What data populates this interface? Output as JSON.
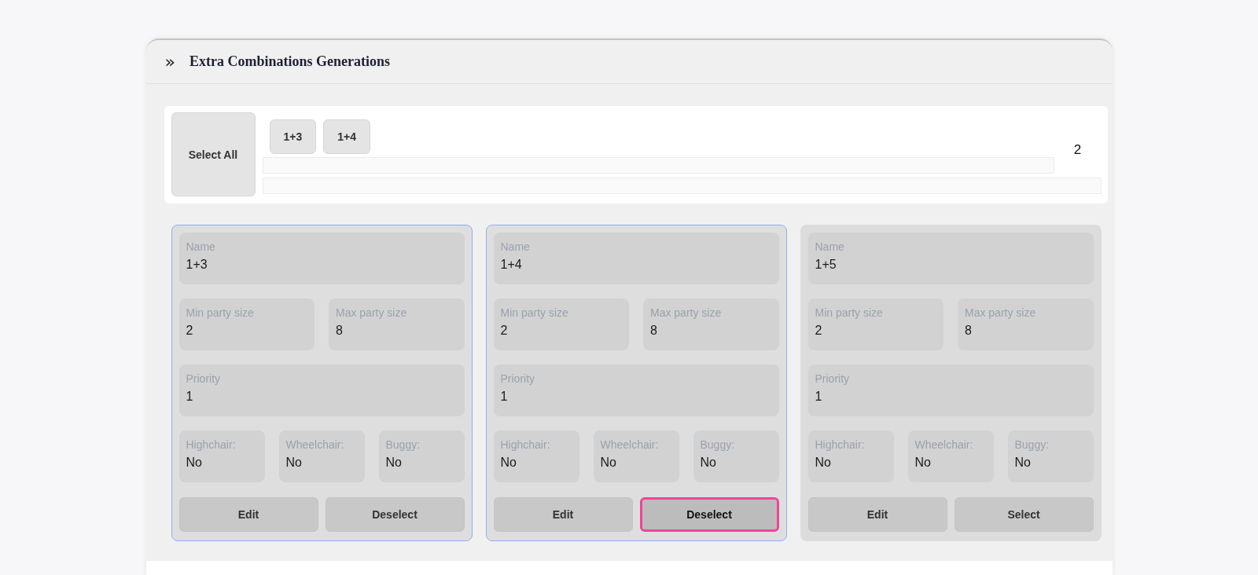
{
  "header": {
    "toggle": "»",
    "title": "Extra Combinations Generations"
  },
  "toolbar": {
    "select_all": "Select All",
    "chips": [
      "1+3",
      "1+4"
    ],
    "count": "2"
  },
  "combinations": [
    {
      "selected": true,
      "name": {
        "label": "Name",
        "value": "1+3"
      },
      "min": {
        "label": "Min party size",
        "value": "2"
      },
      "max": {
        "label": "Max party size",
        "value": "8"
      },
      "priority": {
        "label": "Priority",
        "value": "1"
      },
      "flags": [
        {
          "label": "Highchair:",
          "value": "No"
        },
        {
          "label": "Wheelchair:",
          "value": "No"
        },
        {
          "label": "Buggy:",
          "value": "No"
        }
      ],
      "buttons": [
        {
          "label": "Edit",
          "focused": false
        },
        {
          "label": "Deselect",
          "focused": false
        }
      ]
    },
    {
      "selected": true,
      "name": {
        "label": "Name",
        "value": "1+4"
      },
      "min": {
        "label": "Min party size",
        "value": "2"
      },
      "max": {
        "label": "Max party size",
        "value": "8"
      },
      "priority": {
        "label": "Priority",
        "value": "1"
      },
      "flags": [
        {
          "label": "Highchair:",
          "value": "No"
        },
        {
          "label": "Wheelchair:",
          "value": "No"
        },
        {
          "label": "Buggy:",
          "value": "No"
        }
      ],
      "buttons": [
        {
          "label": "Edit",
          "focused": false
        },
        {
          "label": "Deselect",
          "focused": true
        }
      ]
    },
    {
      "selected": false,
      "name": {
        "label": "Name",
        "value": "1+5"
      },
      "min": {
        "label": "Min party size",
        "value": "2"
      },
      "max": {
        "label": "Max party size",
        "value": "8"
      },
      "priority": {
        "label": "Priority",
        "value": "1"
      },
      "flags": [
        {
          "label": "Highchair:",
          "value": "No"
        },
        {
          "label": "Wheelchair:",
          "value": "No"
        },
        {
          "label": "Buggy:",
          "value": "No"
        }
      ],
      "buttons": [
        {
          "label": "Edit",
          "focused": false
        },
        {
          "label": "Select",
          "focused": false
        }
      ]
    }
  ]
}
